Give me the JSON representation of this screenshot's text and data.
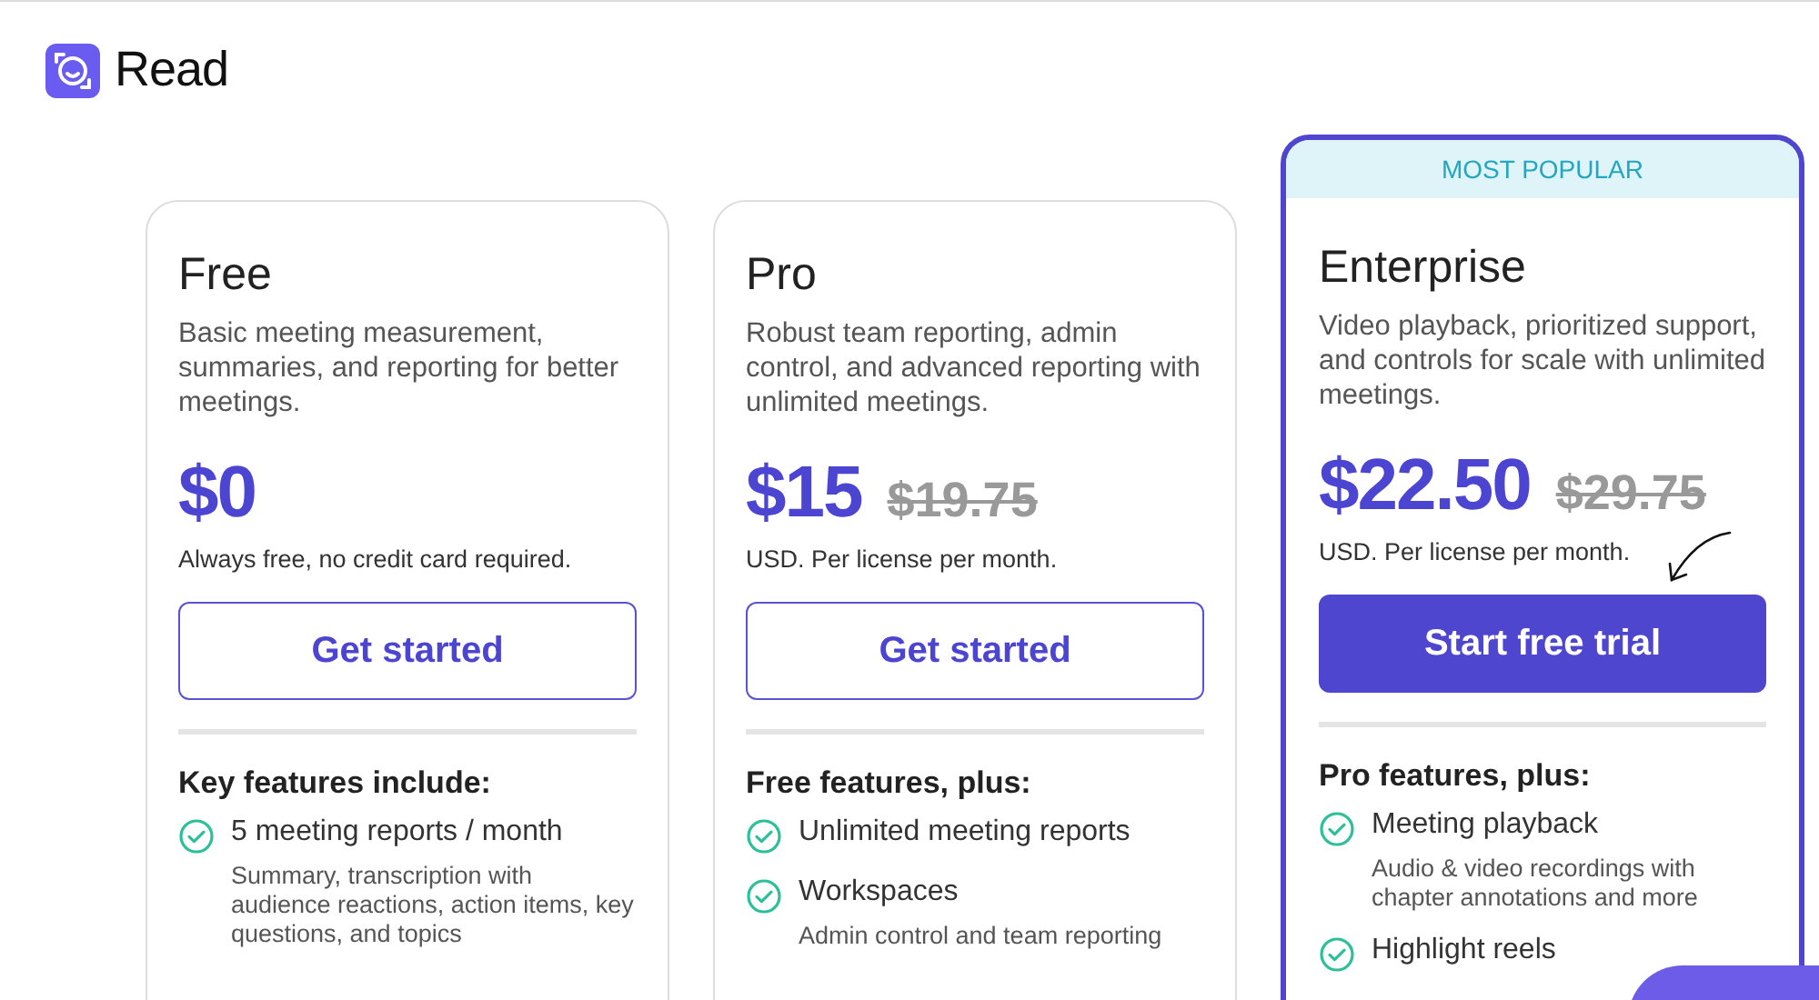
{
  "brand": {
    "name": "Read"
  },
  "plans": [
    {
      "name": "Free",
      "description": "Basic meeting measurement, summaries, and reporting for better meetings.",
      "price": "$0",
      "note": "Always free, no credit card required.",
      "button": {
        "label": "Get started",
        "kind": "outline"
      },
      "features_heading": "Key features include:",
      "features": [
        {
          "title": "5 meeting reports / month",
          "detail": "Summary, transcription with audience reactions, action items, key questions, and topics"
        }
      ]
    },
    {
      "name": "Pro",
      "description": "Robust team reporting, admin control, and advanced reporting with unlimited meetings.",
      "price": "$15",
      "old_price": "$19.75",
      "note": "USD. Per license per month.",
      "button": {
        "label": "Get started",
        "kind": "outline"
      },
      "features_heading": "Free features, plus:",
      "features": [
        {
          "title": "Unlimited meeting reports"
        },
        {
          "title": "Workspaces",
          "detail": "Admin control and team reporting"
        }
      ]
    },
    {
      "name": "Enterprise",
      "badge": "MOST POPULAR",
      "description": "Video playback, prioritized support, and controls for scale with unlimited meetings.",
      "price": "$22.50",
      "old_price": "$29.75",
      "note": "USD. Per license per month.",
      "button": {
        "label": "Start free trial",
        "kind": "filled"
      },
      "features_heading": "Pro features, plus:",
      "features": [
        {
          "title": "Meeting playback",
          "detail": "Audio & video recordings with chapter annotations and more"
        },
        {
          "title": "Highlight reels"
        }
      ]
    }
  ]
}
